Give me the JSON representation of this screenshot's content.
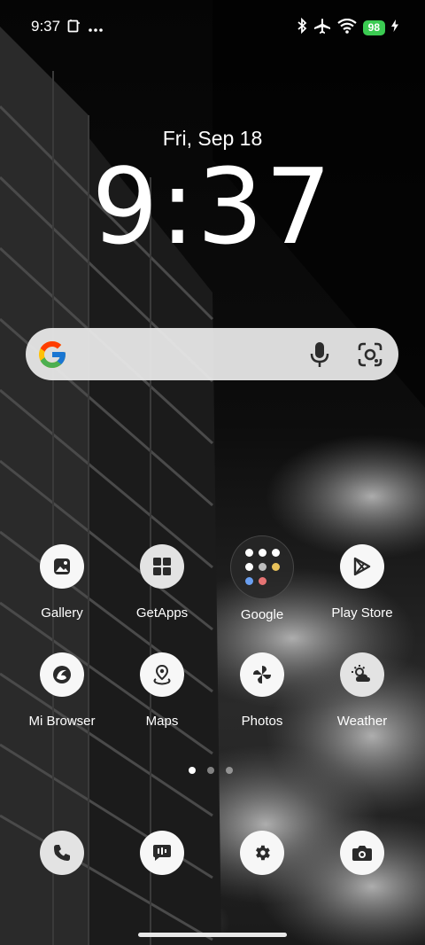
{
  "status_bar": {
    "time": "9:37",
    "battery": "98",
    "icons": [
      "screenshot-icon",
      "more-icon",
      "bluetooth-icon",
      "airplane-icon",
      "wifi-icon",
      "battery-icon",
      "charging-icon"
    ]
  },
  "lockscreen": {
    "date": "Fri, Sep 18",
    "clock": "9:37"
  },
  "search": {
    "icons": [
      "google-logo",
      "mic-icon",
      "lens-icon"
    ]
  },
  "apps": [
    {
      "label": "Gallery",
      "icon": "gallery-icon"
    },
    {
      "label": "GetApps",
      "icon": "getapps-icon"
    },
    {
      "label": "Google",
      "icon": "google-folder"
    },
    {
      "label": "Play Store",
      "icon": "play-store-icon"
    },
    {
      "label": "Mi Browser",
      "icon": "browser-icon"
    },
    {
      "label": "Maps",
      "icon": "maps-icon"
    },
    {
      "label": "Photos",
      "icon": "photos-icon"
    },
    {
      "label": "Weather",
      "icon": "weather-icon"
    }
  ],
  "page_indicator": {
    "pages": 3,
    "current": 1
  },
  "dock": [
    {
      "icon": "phone-icon"
    },
    {
      "icon": "messages-icon"
    },
    {
      "icon": "settings-icon"
    },
    {
      "icon": "camera-icon"
    }
  ]
}
